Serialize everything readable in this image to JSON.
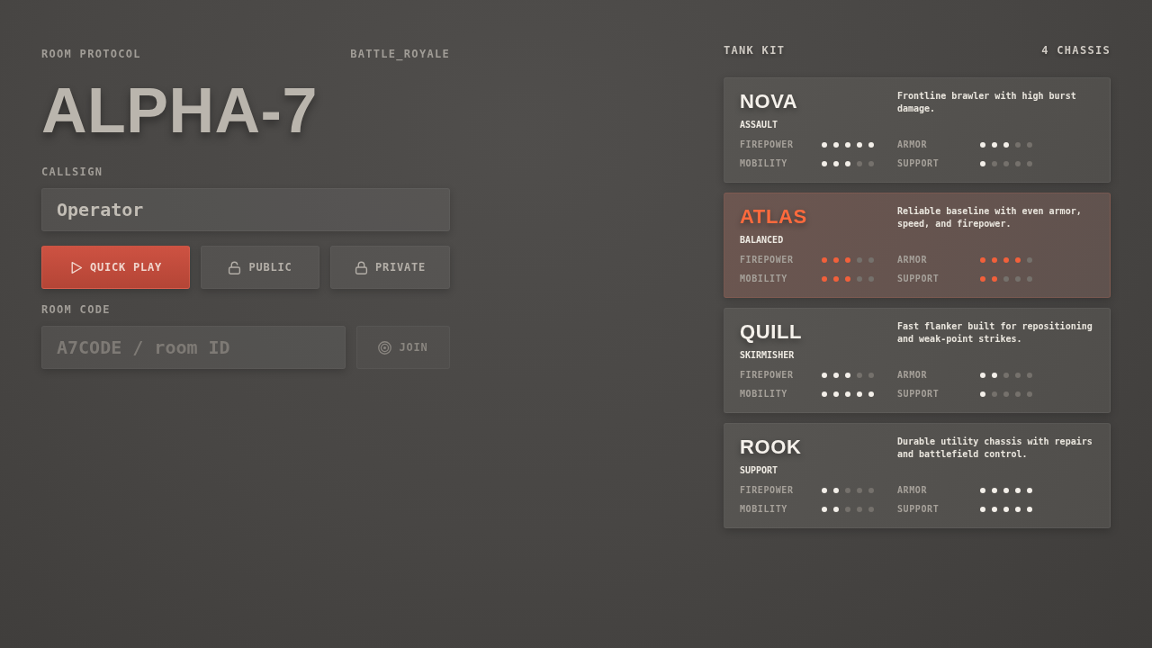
{
  "room": {
    "label": "ROOM PROTOCOL",
    "mode": "BATTLE_ROYALE",
    "name": "ALPHA-7"
  },
  "callsign": {
    "label": "CALLSIGN",
    "value": "Operator"
  },
  "actions": [
    {
      "kind": "play",
      "label": "QUICK PLAY",
      "primary": true
    },
    {
      "kind": "unlocked",
      "label": "PUBLIC",
      "primary": false
    },
    {
      "kind": "locked",
      "label": "PRIVATE",
      "primary": false
    }
  ],
  "room_code": {
    "label": "ROOM CODE",
    "placeholder": "A7CODE / room ID",
    "join": {
      "label": "JOIN",
      "disabled": true
    }
  },
  "kit": {
    "title": "TANK KIT",
    "count": "4 CHASSIS",
    "chassis": [
      {
        "name": "NOVA",
        "role": "ASSAULT",
        "description": "Frontline brawler with high burst damage.",
        "selected": false,
        "stats": [
          {
            "label": "FIREPOWER",
            "stars": 5
          },
          {
            "label": "ARMOR",
            "stars": 3
          },
          {
            "label": "MOBILITY",
            "stars": 3
          },
          {
            "label": "SUPPORT",
            "stars": 1
          }
        ]
      },
      {
        "name": "ATLAS",
        "role": "BALANCED",
        "description": "Reliable baseline with even armor, speed, and firepower.",
        "selected": true,
        "stats": [
          {
            "label": "FIREPOWER",
            "stars": 3
          },
          {
            "label": "ARMOR",
            "stars": 4
          },
          {
            "label": "MOBILITY",
            "stars": 3
          },
          {
            "label": "SUPPORT",
            "stars": 2
          }
        ]
      },
      {
        "name": "QUILL",
        "role": "SKIRMISHER",
        "description": "Fast flanker built for repositioning and weak-point strikes.",
        "selected": false,
        "stats": [
          {
            "label": "FIREPOWER",
            "stars": 3
          },
          {
            "label": "ARMOR",
            "stars": 2
          },
          {
            "label": "MOBILITY",
            "stars": 5
          },
          {
            "label": "SUPPORT",
            "stars": 1
          }
        ]
      },
      {
        "name": "ROOK",
        "role": "SUPPORT",
        "description": "Durable utility chassis with repairs and battlefield control.",
        "selected": false,
        "stats": [
          {
            "label": "FIREPOWER",
            "stars": 2
          },
          {
            "label": "ARMOR",
            "stars": 5
          },
          {
            "label": "MOBILITY",
            "stars": 2
          },
          {
            "label": "SUPPORT",
            "stars": 5
          }
        ]
      }
    ]
  }
}
